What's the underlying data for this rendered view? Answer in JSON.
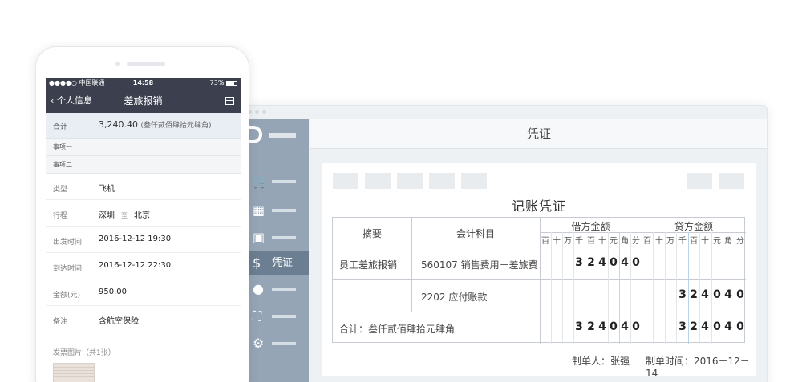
{
  "desktop": {
    "window_title": "凭证",
    "sidebar": {
      "active_label": "凭证"
    },
    "voucher": {
      "title": "记账凭证",
      "columns": {
        "summary": "摘要",
        "account": "会计科目",
        "debit": "借方金额",
        "credit": "贷方金额"
      },
      "digit_headers": [
        "百",
        "十",
        "万",
        "千",
        "百",
        "十",
        "元",
        "角",
        "分"
      ],
      "rows": [
        {
          "summary": "员工差旅报销",
          "account": "560107 销售费用－差旅费",
          "debit": "324040",
          "credit": ""
        },
        {
          "summary": "",
          "account": "2202 应付账款",
          "debit": "",
          "credit": "324040"
        }
      ],
      "total": {
        "label": "合计：叁仟贰佰肆拾元肆角",
        "debit": "324040",
        "credit": "324040"
      },
      "maker": "制单人：张强",
      "date": "制单时间：2016－12－14"
    }
  },
  "phone": {
    "status": {
      "carrier": "●●●●○ 中国联通",
      "time": "14:58",
      "battery": "73%"
    },
    "nav": {
      "back": "个人信息",
      "title": "差旅报销"
    },
    "total": {
      "label": "合计",
      "amount": "3,240.40",
      "amount_words": "(叁仟贰佰肆拾元肆角)"
    },
    "sections": [
      "事项一",
      "事项二"
    ],
    "fields": [
      {
        "key": "类型",
        "value": "飞机"
      },
      {
        "key": "行程",
        "from": "深圳",
        "sep": "至",
        "to": "北京"
      },
      {
        "key": "出发时间",
        "value": "2016-12-12 19:30"
      },
      {
        "key": "到达时间",
        "value": "2016-12-12 22:30"
      },
      {
        "key": "金额(元)",
        "value": "950.00"
      },
      {
        "key": "备注",
        "value": "含航空保险"
      }
    ],
    "invoice_title": "发票图片（共1张）"
  }
}
